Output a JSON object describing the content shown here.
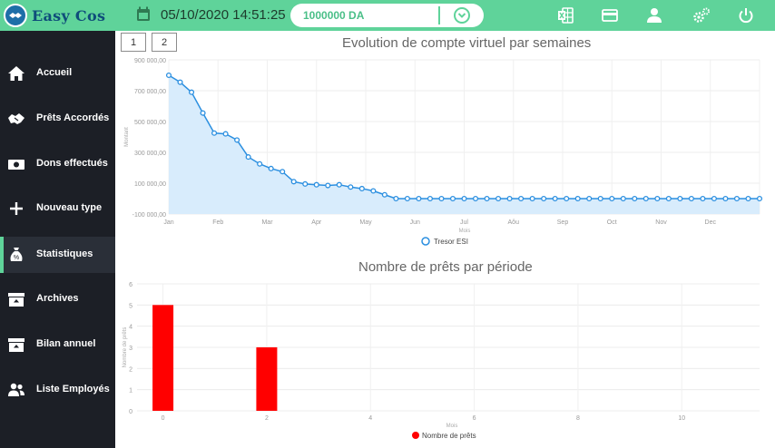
{
  "app": {
    "name": "Easy Cos"
  },
  "header": {
    "datetime": "05/10/2020 14:51:25",
    "balance": "1000000 DA"
  },
  "icons": {
    "logo": "handshake-globe-icon",
    "calendar": "calendar-icon",
    "excel": "excel-icon",
    "card": "credit-card-icon",
    "user": "user-icon",
    "settings": "gears-icon",
    "power": "power-icon",
    "dropdown": "chevron-down-icon"
  },
  "sidebar": {
    "items": [
      {
        "label": "Accueil",
        "icon": "home-icon"
      },
      {
        "label": "Prêts Accordés",
        "icon": "handshake-icon"
      },
      {
        "label": "Dons effectués",
        "icon": "money-bill-icon"
      },
      {
        "label": "Nouveau type",
        "icon": "plus-icon"
      },
      {
        "label": "Statistiques",
        "icon": "money-bag-icon",
        "active": true
      },
      {
        "label": "Archives",
        "icon": "archive-icon"
      },
      {
        "label": "Bilan annuel",
        "icon": "archive-icon"
      },
      {
        "label": "Liste Employés",
        "icon": "users-icon"
      }
    ]
  },
  "pagination": {
    "buttons": [
      "1",
      "2"
    ]
  },
  "colors": {
    "accent": "#5fd39a",
    "sidebar": "#1c1f26",
    "line": "#2b8fe0",
    "area": "#d8ecfc",
    "bar": "#ff0000"
  },
  "chart_data": [
    {
      "type": "line",
      "title": "Evolution de compte virtuel par semaines",
      "xlabel": "Mois",
      "ylabel": "Montant",
      "x_tick_labels": [
        "Jan",
        "Feb",
        "Mar",
        "Apr",
        "May",
        "Jun",
        "Jul",
        "Aôu",
        "Sep",
        "Oct",
        "Nov",
        "Dec"
      ],
      "y_tick_labels": [
        "-100 000,00",
        "100 000,00",
        "300 000,00",
        "500 000,00",
        "700 000,00",
        "900 000,00"
      ],
      "ylim": [
        -100000,
        900000
      ],
      "grid": true,
      "legend": "bottom",
      "fill": true,
      "series": [
        {
          "name": "Tresor ESI",
          "values": [
            800000,
            755000,
            690000,
            555000,
            425000,
            420000,
            380000,
            270000,
            225000,
            195000,
            175000,
            110000,
            95000,
            90000,
            85000,
            90000,
            75000,
            65000,
            50000,
            25000,
            0,
            0,
            0,
            0,
            0,
            0,
            0,
            0,
            0,
            0,
            0,
            0,
            0,
            0,
            0,
            0,
            0,
            0,
            0,
            0,
            0,
            0,
            0,
            0,
            0,
            0,
            0,
            0,
            0,
            0,
            0,
            0,
            0
          ]
        }
      ]
    },
    {
      "type": "bar",
      "title": "Nombre de prêts par période",
      "xlabel": "Mois",
      "ylabel": "Nombre de prêts",
      "x_tick_labels": [
        "0",
        "2",
        "4",
        "6",
        "8",
        "10"
      ],
      "y_tick_labels": [
        "0",
        "1",
        "2",
        "3",
        "4",
        "5",
        "6"
      ],
      "xlim": [
        -0.5,
        11.5
      ],
      "ylim": [
        0,
        6
      ],
      "grid": true,
      "legend": "bottom",
      "series": [
        {
          "name": "Nombre de prêts",
          "x": [
            0,
            2
          ],
          "values": [
            5,
            3
          ]
        }
      ]
    }
  ]
}
